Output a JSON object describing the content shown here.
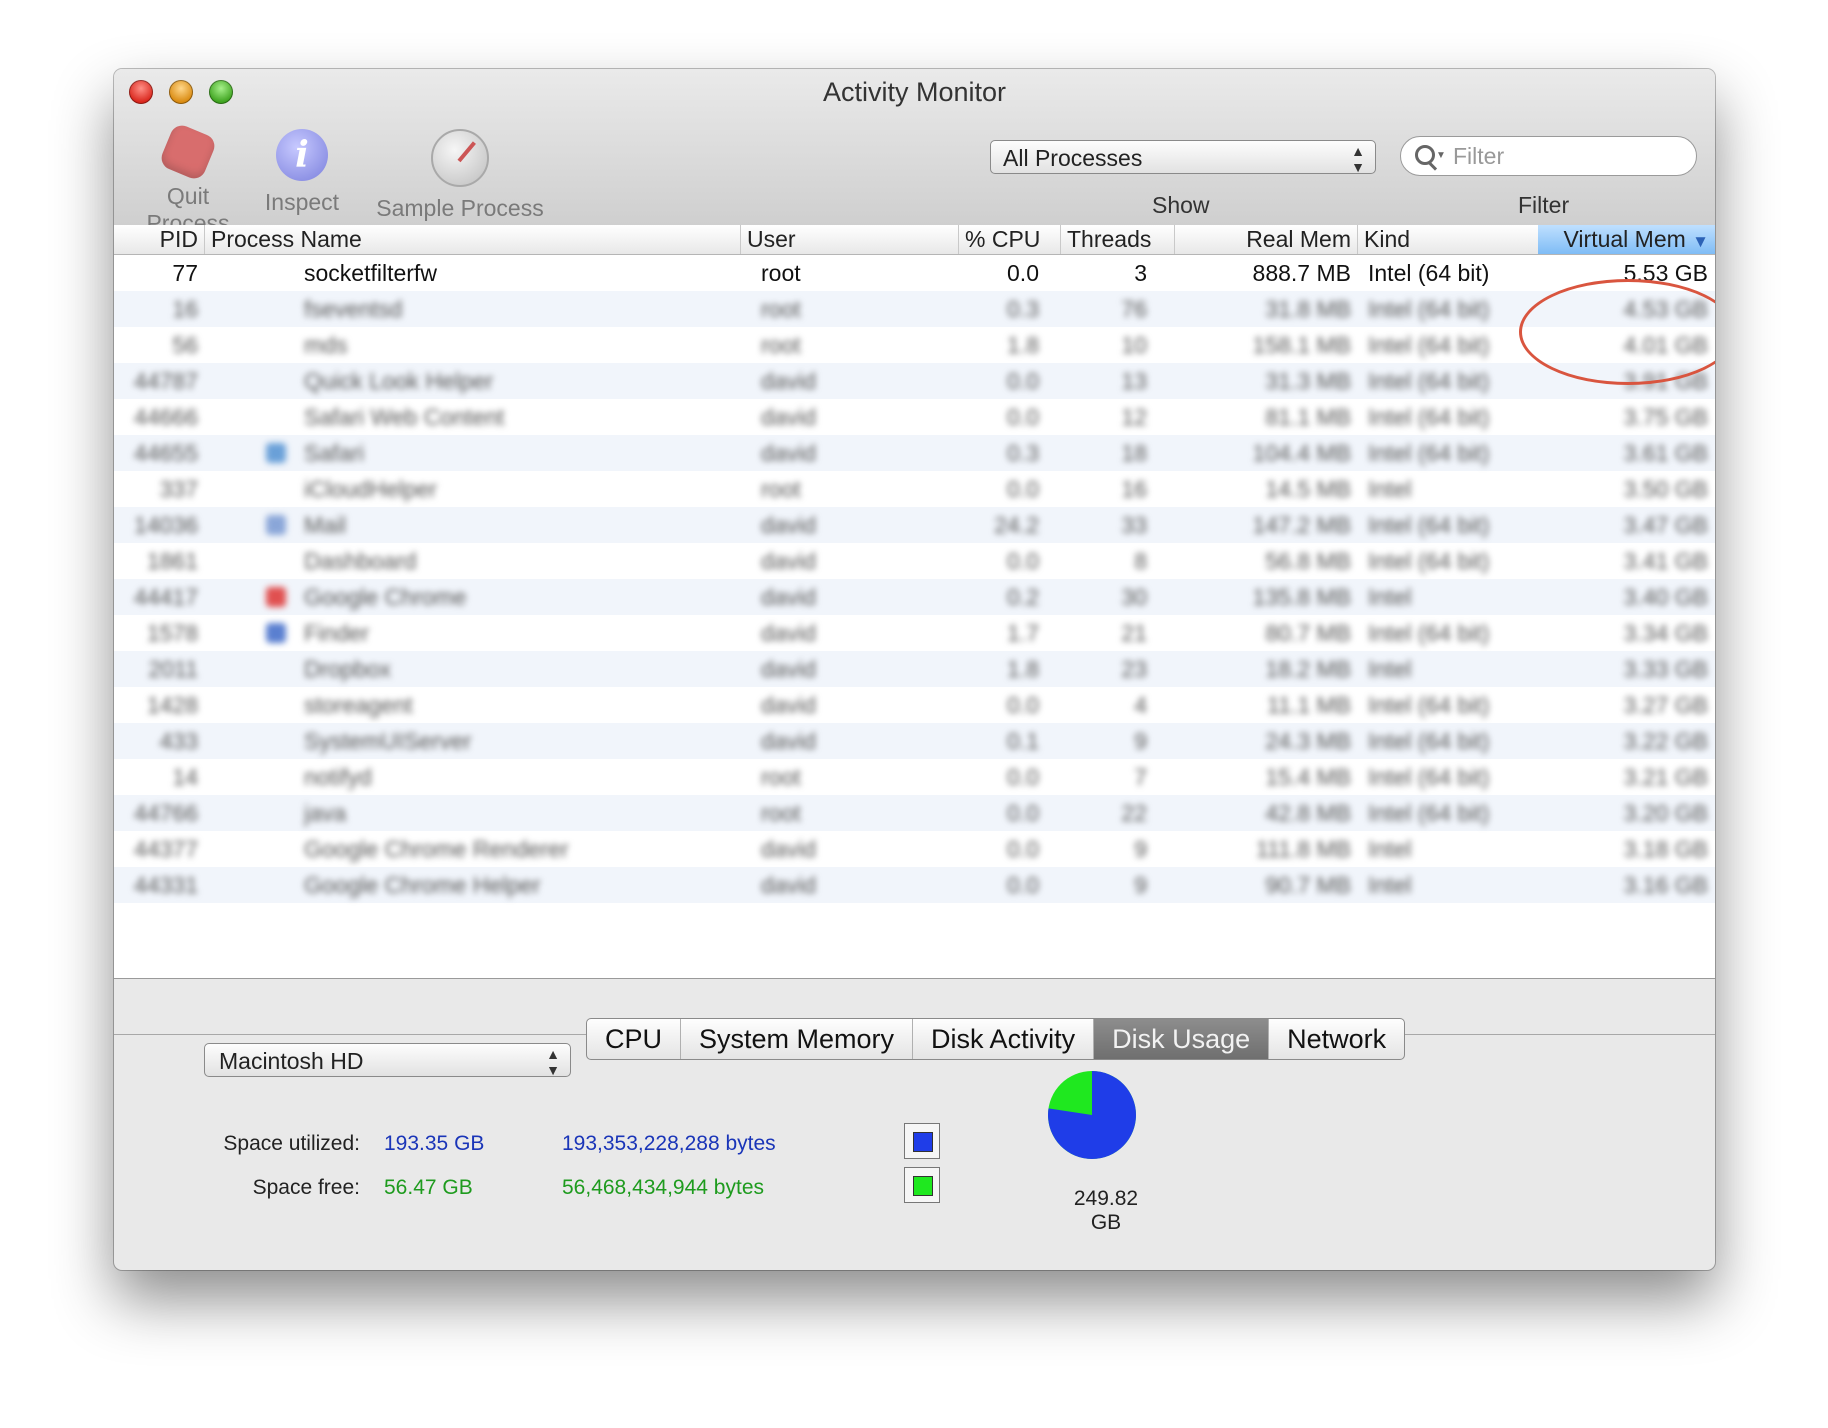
{
  "window": {
    "title": "Activity Monitor"
  },
  "toolbar": {
    "quit_label": "Quit Process",
    "inspect_label": "Inspect",
    "sample_label": "Sample Process",
    "show_value": "All Processes",
    "show_caption": "Show",
    "filter_placeholder": "Filter",
    "filter_caption": "Filter"
  },
  "table": {
    "columns": [
      "PID",
      "Process Name",
      "User",
      "% CPU",
      "Threads",
      "Real Mem",
      "Kind",
      "Virtual Mem"
    ],
    "sorted_column": "Virtual Mem",
    "rows": [
      {
        "pid": "77",
        "name": "socketfilterfw",
        "user": "root",
        "cpu": "0.0",
        "threads": "3",
        "real": "888.7 MB",
        "kind": "Intel (64 bit)",
        "virt": "5.53 GB"
      },
      {
        "pid": "16",
        "name": "fseventsd",
        "user": "root",
        "cpu": "0.3",
        "threads": "76",
        "real": "31.8 MB",
        "kind": "Intel (64 bit)",
        "virt": "4.53 GB"
      },
      {
        "pid": "56",
        "name": "mds",
        "user": "root",
        "cpu": "1.8",
        "threads": "10",
        "real": "158.1 MB",
        "kind": "Intel (64 bit)",
        "virt": "4.01 GB"
      },
      {
        "pid": "44787",
        "name": "Quick Look Helper",
        "user": "david",
        "cpu": "0.0",
        "threads": "13",
        "real": "31.3 MB",
        "kind": "Intel (64 bit)",
        "virt": "3.91 GB"
      },
      {
        "pid": "44666",
        "name": "Safari Web Content",
        "user": "david",
        "cpu": "0.0",
        "threads": "12",
        "real": "81.1 MB",
        "kind": "Intel (64 bit)",
        "virt": "3.75 GB"
      },
      {
        "pid": "44655",
        "name": "Safari",
        "user": "david",
        "cpu": "0.3",
        "threads": "18",
        "real": "104.4 MB",
        "kind": "Intel (64 bit)",
        "virt": "3.61 GB"
      },
      {
        "pid": "337",
        "name": "iCloudHelper",
        "user": "root",
        "cpu": "0.0",
        "threads": "16",
        "real": "14.5 MB",
        "kind": "Intel",
        "virt": "3.50 GB"
      },
      {
        "pid": "14036",
        "name": "Mail",
        "user": "david",
        "cpu": "24.2",
        "threads": "33",
        "real": "147.2 MB",
        "kind": "Intel (64 bit)",
        "virt": "3.47 GB"
      },
      {
        "pid": "1861",
        "name": "Dashboard",
        "user": "david",
        "cpu": "0.0",
        "threads": "8",
        "real": "56.8 MB",
        "kind": "Intel (64 bit)",
        "virt": "3.41 GB"
      },
      {
        "pid": "44417",
        "name": "Google Chrome",
        "user": "david",
        "cpu": "0.2",
        "threads": "30",
        "real": "135.8 MB",
        "kind": "Intel",
        "virt": "3.40 GB"
      },
      {
        "pid": "1578",
        "name": "Finder",
        "user": "david",
        "cpu": "1.7",
        "threads": "21",
        "real": "80.7 MB",
        "kind": "Intel (64 bit)",
        "virt": "3.34 GB"
      },
      {
        "pid": "2011",
        "name": "Dropbox",
        "user": "david",
        "cpu": "1.8",
        "threads": "23",
        "real": "18.2 MB",
        "kind": "Intel",
        "virt": "3.33 GB"
      },
      {
        "pid": "1428",
        "name": "storeagent",
        "user": "david",
        "cpu": "0.0",
        "threads": "4",
        "real": "11.1 MB",
        "kind": "Intel (64 bit)",
        "virt": "3.27 GB"
      },
      {
        "pid": "433",
        "name": "SystemUIServer",
        "user": "david",
        "cpu": "0.1",
        "threads": "9",
        "real": "24.3 MB",
        "kind": "Intel (64 bit)",
        "virt": "3.22 GB"
      },
      {
        "pid": "14",
        "name": "notifyd",
        "user": "root",
        "cpu": "0.0",
        "threads": "7",
        "real": "15.4 MB",
        "kind": "Intel (64 bit)",
        "virt": "3.21 GB"
      },
      {
        "pid": "44766",
        "name": "java",
        "user": "root",
        "cpu": "0.0",
        "threads": "22",
        "real": "42.8 MB",
        "kind": "Intel (64 bit)",
        "virt": "3.20 GB"
      },
      {
        "pid": "44377",
        "name": "Google Chrome Renderer",
        "user": "david",
        "cpu": "0.0",
        "threads": "9",
        "real": "111.8 MB",
        "kind": "Intel",
        "virt": "3.18 GB"
      },
      {
        "pid": "44331",
        "name": "Google Chrome Helper",
        "user": "david",
        "cpu": "0.0",
        "threads": "9",
        "real": "90.7 MB",
        "kind": "Intel",
        "virt": "3.16 GB"
      }
    ]
  },
  "tabs": [
    {
      "label": "CPU",
      "active": false
    },
    {
      "label": "System Memory",
      "active": false
    },
    {
      "label": "Disk Activity",
      "active": false
    },
    {
      "label": "Disk Usage",
      "active": true
    },
    {
      "label": "Network",
      "active": false
    }
  ],
  "disk": {
    "volume": "Macintosh HD",
    "used_label": "Space utilized:",
    "used_value": "193.35 GB",
    "used_bytes": "193,353,228,288 bytes",
    "free_label": "Space free:",
    "free_value": "56.47 GB",
    "free_bytes": "56,468,434,944 bytes",
    "total": "249.82 GB",
    "used_fraction": 0.774,
    "used_color": "#1f3de8",
    "free_color": "#1fe81f"
  }
}
